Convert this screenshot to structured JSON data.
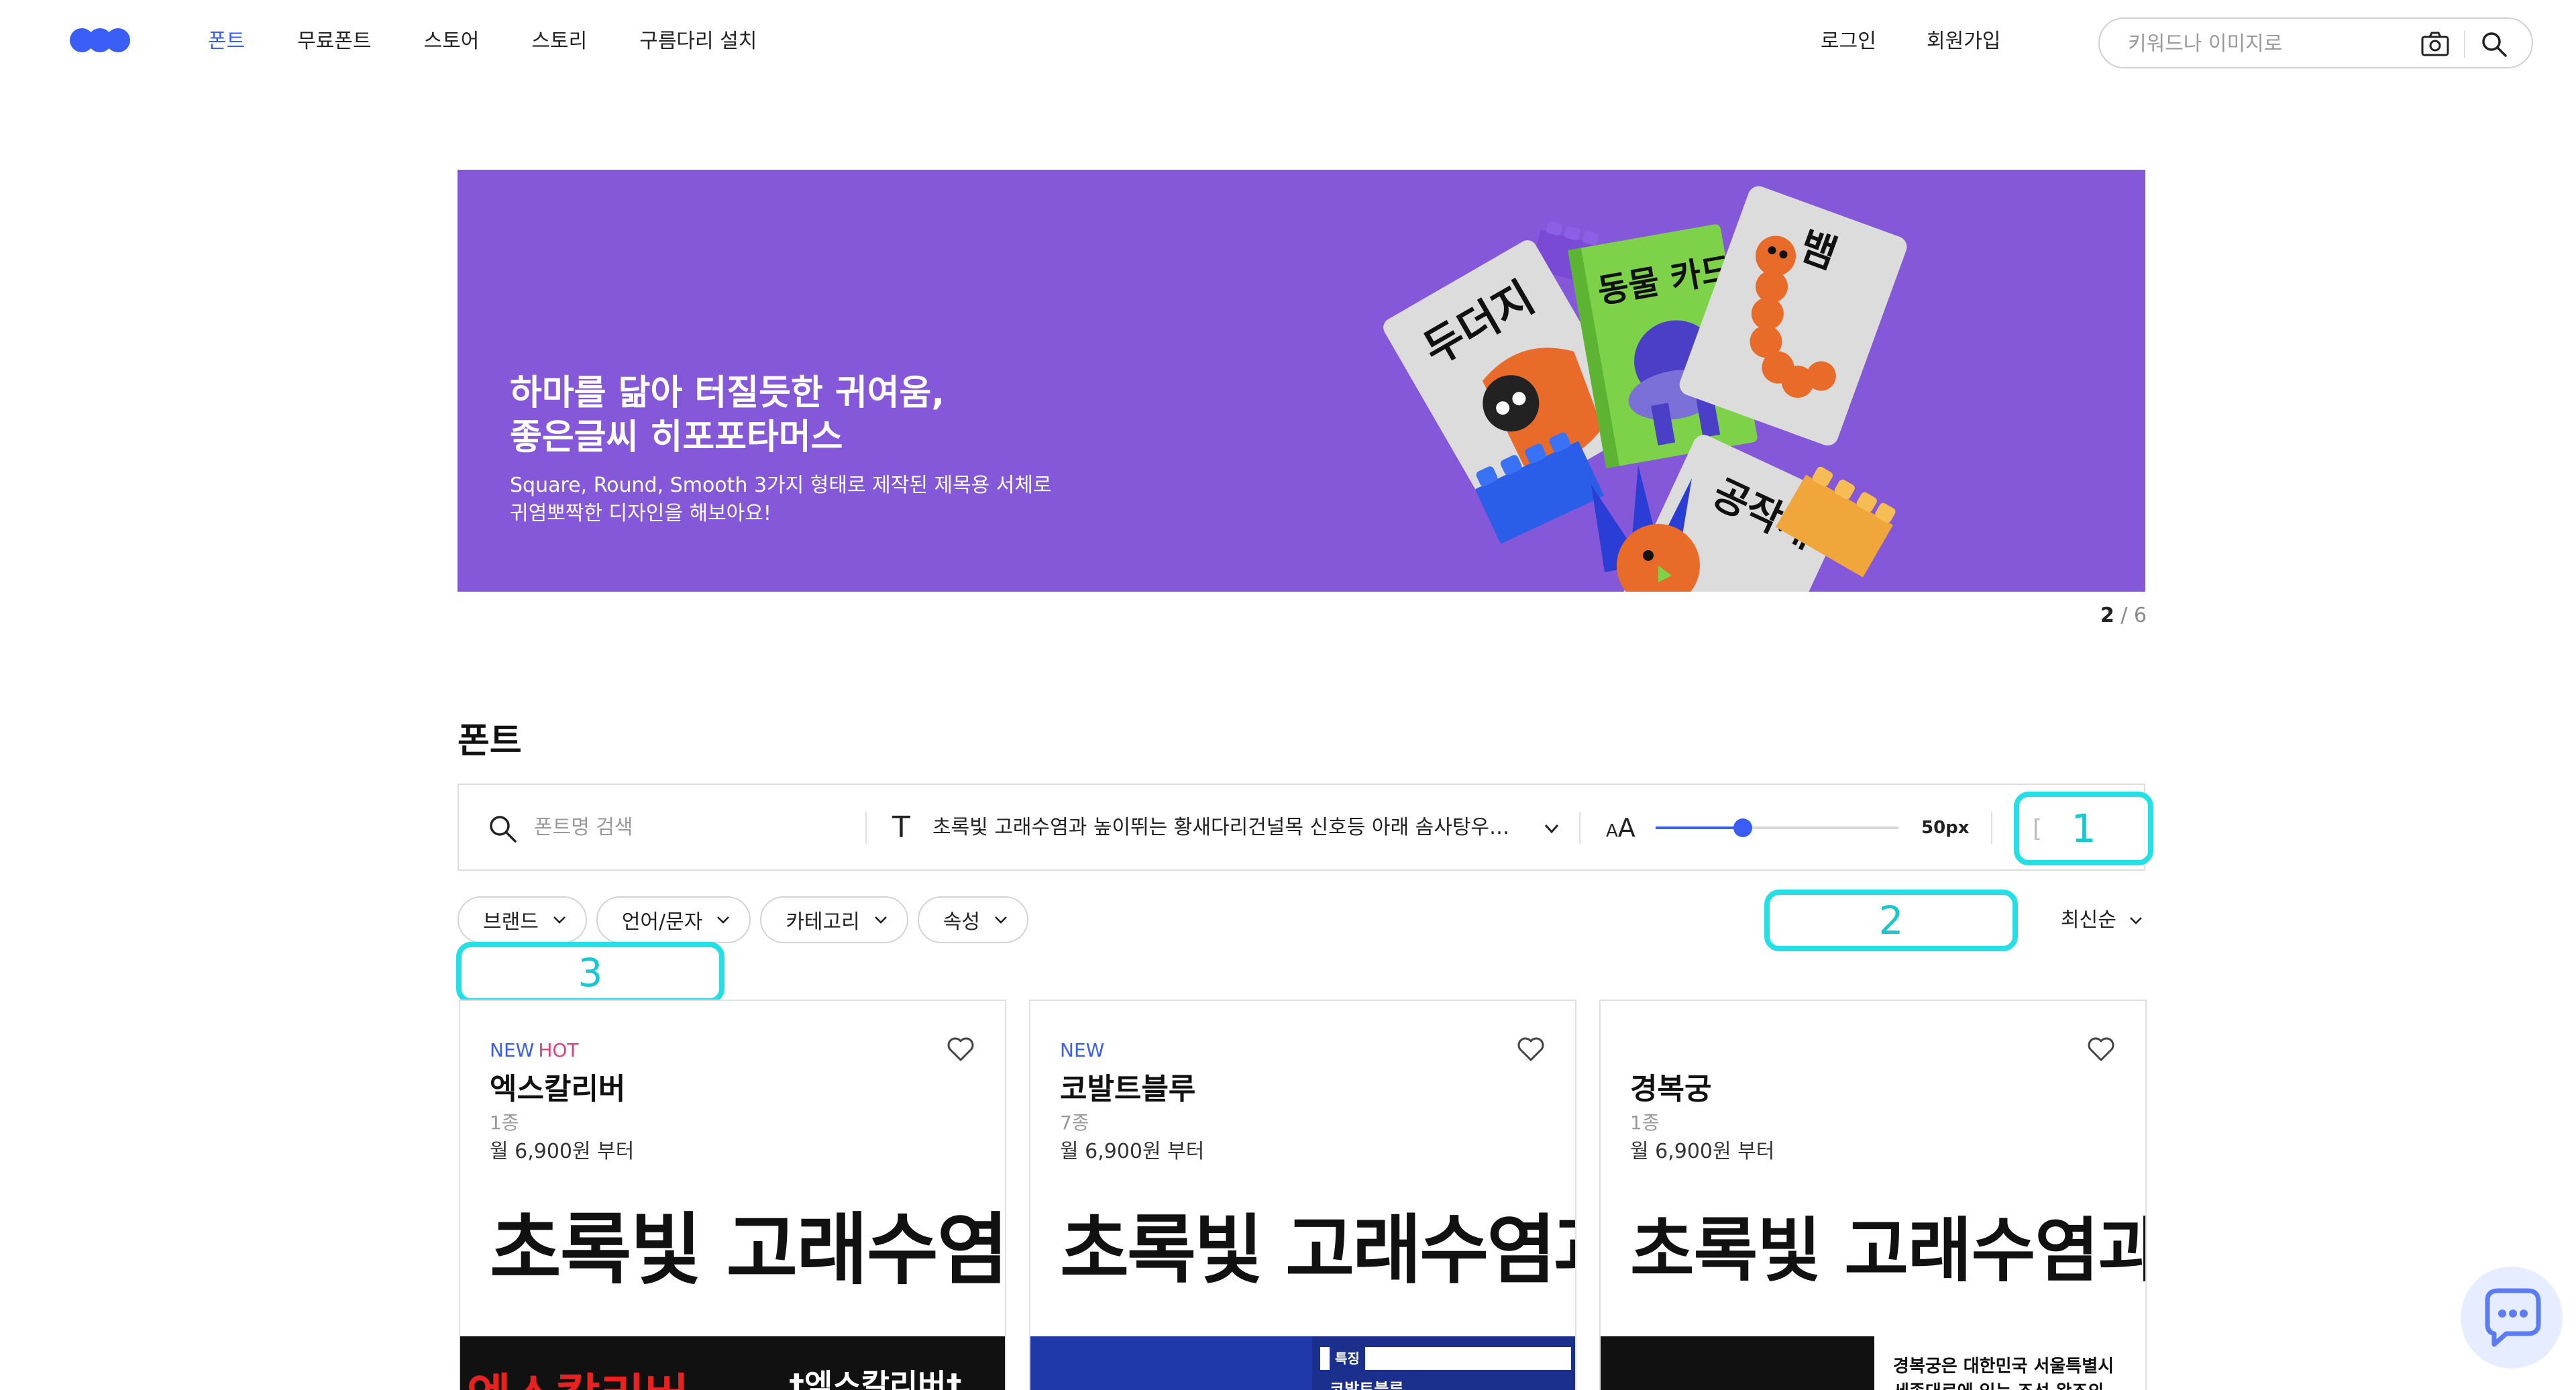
{
  "header": {
    "nav": [
      "폰트",
      "무료폰트",
      "스토어",
      "스토리",
      "구름다리 설치"
    ],
    "login": "로그인",
    "signup": "회원가입",
    "search_placeholder": "키워드나 이미지로"
  },
  "banner": {
    "title": "하마를 닮아 터질듯한 귀여움,\n좋은글씨 히포포타머스",
    "description": "Square, Round, Smooth 3가지 형태로 제작된 제목용 서체로\n귀염뽀짝한 디자인을 해보아요!",
    "art_texts": [
      "두더지",
      "동물 카드",
      "뱀",
      "공작새"
    ],
    "page_current": "2",
    "page_total": "/ 6"
  },
  "fonts_section": {
    "title": "폰트",
    "search_placeholder": "폰트명 검색",
    "sample_text": "초록빛 고래수염과 높이뛰는 황새다리건널목 신호등 아래 솜사탕우주...",
    "size_icon": "AA",
    "font_size_label": "50px",
    "font_size_value": 50,
    "font_size_fraction": 0.36,
    "filters": [
      "브랜드",
      "언어/문자",
      "카테고리",
      "속성"
    ],
    "sort_label": "최신순"
  },
  "annotations": [
    "1",
    "2",
    "3"
  ],
  "cards": [
    {
      "badge_new": "NEW",
      "badge_hot": "HOT",
      "name": "엑스칼리버",
      "count": "1종",
      "price": "월 6,900원 부터",
      "preview": "초록빛 고래수염과",
      "thumb_text": "엑스칼리버",
      "thumb_text2": "†엑스칼리버†"
    },
    {
      "badge_new": "NEW",
      "badge_hot": "",
      "name": "코발트블루",
      "count": "7종",
      "price": "월 6,900원 부터",
      "preview": "초록빛 고래수염과",
      "thumb_text": "특징",
      "thumb_text2": "코발트블루"
    },
    {
      "badge_new": "",
      "badge_hot": "",
      "name": "경복궁",
      "count": "1종",
      "price": "월 6,900원 부터",
      "preview": "초록빛 고래수염과 높",
      "thumb_text": "경복궁은 대한민국 서울특별시",
      "thumb_text2": "세종대로에 있는 조선 왕조의"
    }
  ],
  "colors": {
    "accent": "#3a5ef5",
    "banner_bg": "#8558d9",
    "hot": "#e53d7b",
    "annotation": "#22e0e6"
  }
}
